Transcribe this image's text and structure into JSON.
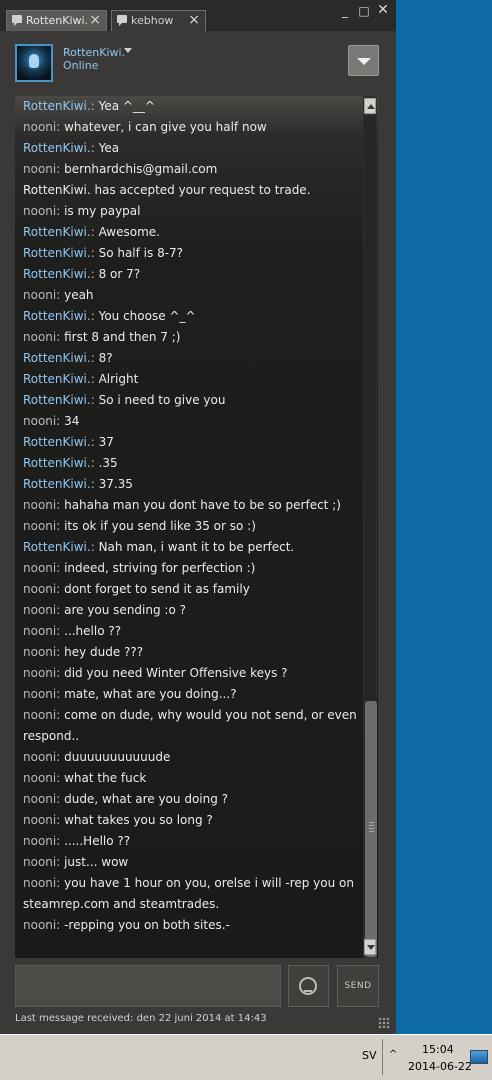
{
  "window": {
    "tabs": [
      {
        "label": "RottenKiwi."
      },
      {
        "label": "kebhow"
      }
    ],
    "controls": {
      "minimize": "_",
      "maximize": "□",
      "close": "✕"
    }
  },
  "header": {
    "username": "RottenKiwi.",
    "status": "Online"
  },
  "messages": [
    {
      "sender": "RottenKiwi.",
      "role": "friend",
      "text": "Yea ^__^"
    },
    {
      "sender": "nooni",
      "role": "self",
      "text": "whatever, i can give you half now"
    },
    {
      "sender": "RottenKiwi.",
      "role": "friend",
      "text": "Yea"
    },
    {
      "sender": "nooni",
      "role": "self",
      "text": "bernhardchis@gmail.com"
    },
    {
      "sender": "",
      "role": "system",
      "text": "RottenKiwi. has accepted your request to trade."
    },
    {
      "sender": "nooni",
      "role": "self",
      "text": "is my paypal"
    },
    {
      "sender": "RottenKiwi.",
      "role": "friend",
      "text": "Awesome."
    },
    {
      "sender": "RottenKiwi.",
      "role": "friend",
      "text": "So half is 8-7?"
    },
    {
      "sender": "RottenKiwi.",
      "role": "friend",
      "text": "8 or 7?"
    },
    {
      "sender": "nooni",
      "role": "self",
      "text": "yeah"
    },
    {
      "sender": "RottenKiwi.",
      "role": "friend",
      "text": "You choose ^_^"
    },
    {
      "sender": "nooni",
      "role": "self",
      "text": "first 8 and then 7 ;)"
    },
    {
      "sender": "RottenKiwi.",
      "role": "friend",
      "text": "8?"
    },
    {
      "sender": "RottenKiwi.",
      "role": "friend",
      "text": "Alright"
    },
    {
      "sender": "RottenKiwi.",
      "role": "friend",
      "text": "So i need to give you"
    },
    {
      "sender": "nooni",
      "role": "self",
      "text": "34"
    },
    {
      "sender": "RottenKiwi.",
      "role": "friend",
      "text": "37"
    },
    {
      "sender": "RottenKiwi.",
      "role": "friend",
      "text": ".35"
    },
    {
      "sender": "RottenKiwi.",
      "role": "friend",
      "text": "37.35"
    },
    {
      "sender": "nooni",
      "role": "self",
      "text": "hahaha man you dont have to be so perfect ;)"
    },
    {
      "sender": "nooni",
      "role": "self",
      "text": "its ok if you send like 35 or so :)"
    },
    {
      "sender": "RottenKiwi.",
      "role": "friend",
      "text": "Nah man, i want it to be perfect."
    },
    {
      "sender": "nooni",
      "role": "self",
      "text": "indeed, striving for perfection :)"
    },
    {
      "sender": "nooni",
      "role": "self",
      "text": "dont forget to send it as family"
    },
    {
      "sender": "nooni",
      "role": "self",
      "text": "are you sending :o ?"
    },
    {
      "sender": "nooni",
      "role": "self",
      "text": "...hello ??"
    },
    {
      "sender": "nooni",
      "role": "self",
      "text": "hey dude ???"
    },
    {
      "sender": "nooni",
      "role": "self",
      "text": "did you need Winter Offensive keys ?"
    },
    {
      "sender": "nooni",
      "role": "self",
      "text": "mate, what are you doing...?"
    },
    {
      "sender": "nooni",
      "role": "self",
      "text": "come on dude, why would you not send, or even respond.."
    },
    {
      "sender": "nooni",
      "role": "self",
      "text": "duuuuuuuuuuude"
    },
    {
      "sender": "nooni",
      "role": "self",
      "text": "what the fuck"
    },
    {
      "sender": "nooni",
      "role": "self",
      "text": "dude, what are you doing ?"
    },
    {
      "sender": "nooni",
      "role": "self",
      "text": "what takes you so long ?"
    },
    {
      "sender": "nooni",
      "role": "self",
      "text": ".....Hello ??"
    },
    {
      "sender": "nooni",
      "role": "self",
      "text": "just... wow"
    },
    {
      "sender": "nooni",
      "role": "self",
      "text": "you have 1 hour on you, orelse i will -rep you on steamrep.com and steamtrades."
    },
    {
      "sender": "nooni",
      "role": "self",
      "text": "-repping you on both sites.-"
    }
  ],
  "composer": {
    "send_label": "SEND",
    "emoticon_icon": "smiley-icon"
  },
  "footer": {
    "last_received": "Last message received: den 22 juni 2014 at 14:43"
  },
  "taskbar": {
    "language": "SV",
    "time": "15:04",
    "date": "2014-06-22"
  },
  "colors": {
    "friend_name": "#8fc6ef",
    "self_name": "#b8b8b8",
    "message_text": "#ebebeb",
    "window_bg": "#3a3937",
    "desktop_bg": "#0e6aa3"
  }
}
